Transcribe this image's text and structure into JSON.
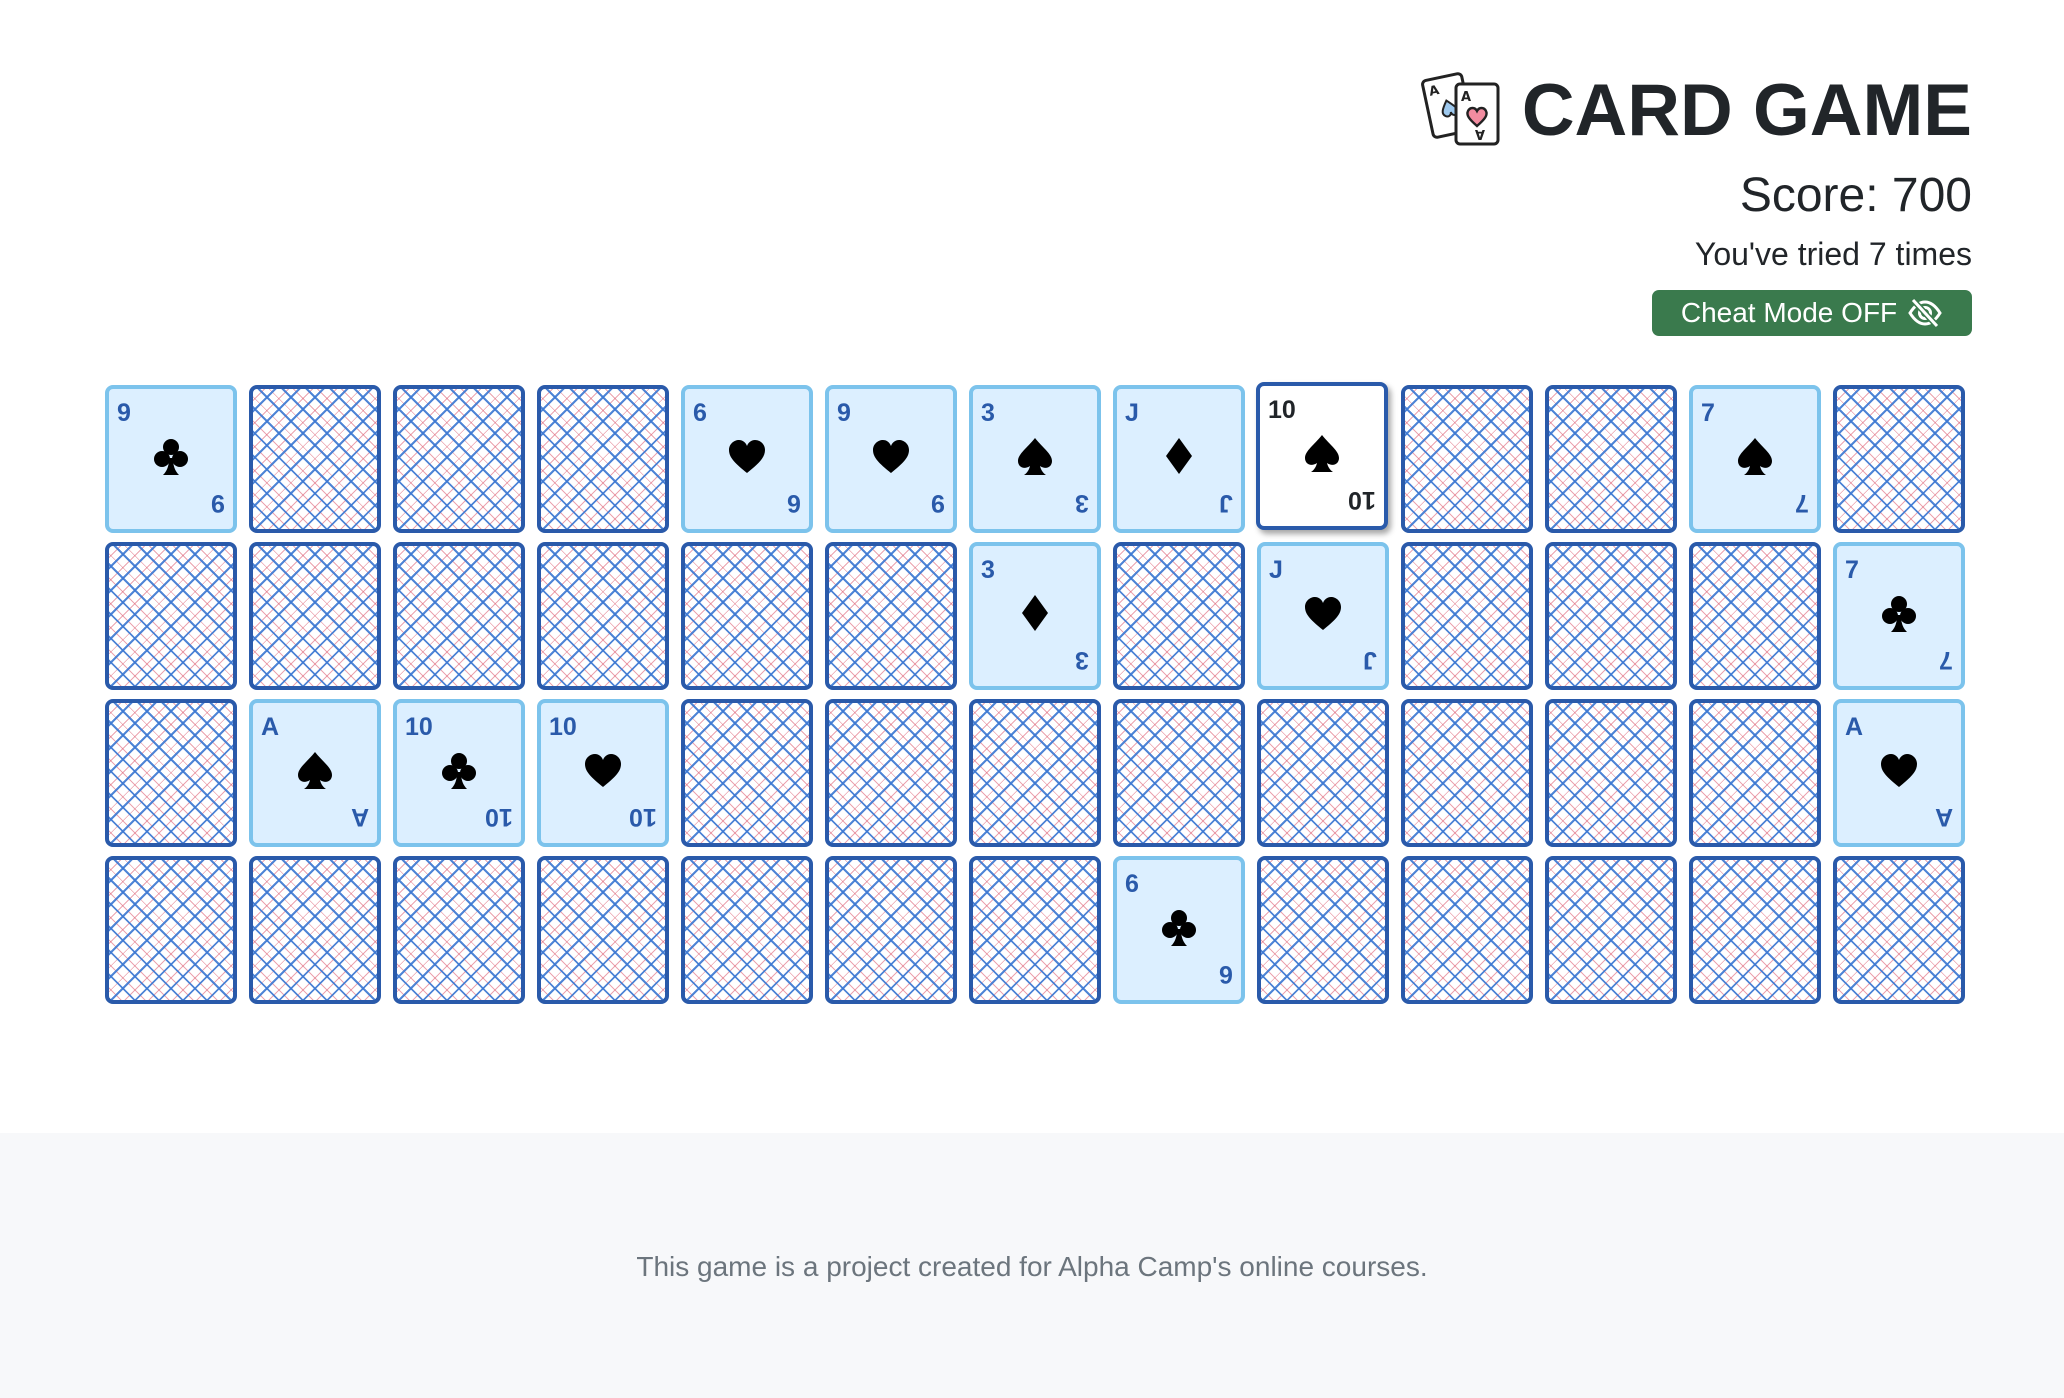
{
  "header": {
    "title": "CARD GAME",
    "score": "Score: 700",
    "tried": "You've tried 7 times",
    "cheat_label": "Cheat Mode OFF",
    "logo_icon": "playing-cards-icon",
    "cheat_icon": "eye-slash-icon"
  },
  "colors": {
    "back_border": "#2a5aaa",
    "front_border": "#7cc3ec",
    "front_bg": "#dcefff",
    "rank_text": "#2a5aaa",
    "cheat_button": "#3a7a4d"
  },
  "cards": [
    {
      "state": "front",
      "rank": "9",
      "suit": "club"
    },
    {
      "state": "back"
    },
    {
      "state": "back"
    },
    {
      "state": "back"
    },
    {
      "state": "front",
      "rank": "6",
      "suit": "heart"
    },
    {
      "state": "front",
      "rank": "9",
      "suit": "heart"
    },
    {
      "state": "front",
      "rank": "3",
      "suit": "spade"
    },
    {
      "state": "front",
      "rank": "J",
      "suit": "diamond"
    },
    {
      "state": "active",
      "rank": "10",
      "suit": "spade"
    },
    {
      "state": "back"
    },
    {
      "state": "back"
    },
    {
      "state": "front",
      "rank": "7",
      "suit": "spade"
    },
    {
      "state": "back"
    },
    {
      "state": "back"
    },
    {
      "state": "back"
    },
    {
      "state": "back"
    },
    {
      "state": "back"
    },
    {
      "state": "back"
    },
    {
      "state": "back"
    },
    {
      "state": "front",
      "rank": "3",
      "suit": "diamond"
    },
    {
      "state": "back"
    },
    {
      "state": "front",
      "rank": "J",
      "suit": "heart"
    },
    {
      "state": "back"
    },
    {
      "state": "back"
    },
    {
      "state": "back"
    },
    {
      "state": "front",
      "rank": "7",
      "suit": "club"
    },
    {
      "state": "back"
    },
    {
      "state": "front",
      "rank": "A",
      "suit": "spade"
    },
    {
      "state": "front",
      "rank": "10",
      "suit": "club"
    },
    {
      "state": "front",
      "rank": "10",
      "suit": "heart"
    },
    {
      "state": "back"
    },
    {
      "state": "back"
    },
    {
      "state": "back"
    },
    {
      "state": "back"
    },
    {
      "state": "back"
    },
    {
      "state": "back"
    },
    {
      "state": "back"
    },
    {
      "state": "back"
    },
    {
      "state": "front",
      "rank": "A",
      "suit": "heart"
    },
    {
      "state": "back"
    },
    {
      "state": "back"
    },
    {
      "state": "back"
    },
    {
      "state": "back"
    },
    {
      "state": "back"
    },
    {
      "state": "back"
    },
    {
      "state": "back"
    },
    {
      "state": "front",
      "rank": "6",
      "suit": "club"
    },
    {
      "state": "back"
    },
    {
      "state": "back"
    },
    {
      "state": "back"
    },
    {
      "state": "back"
    },
    {
      "state": "back"
    }
  ],
  "footer": {
    "text": "This game is a project created for Alpha Camp's online courses."
  }
}
